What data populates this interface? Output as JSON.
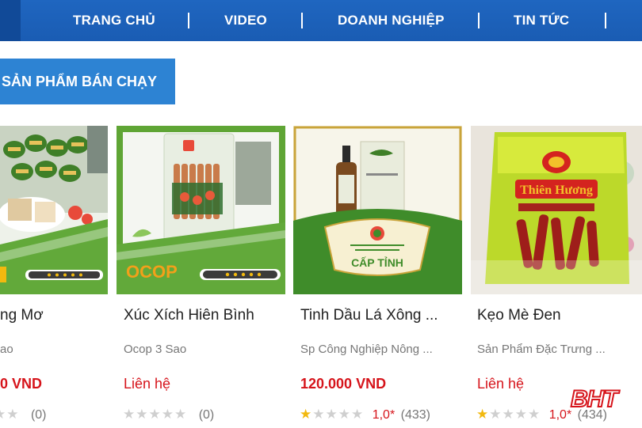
{
  "nav": {
    "items": [
      "TRANG CHỦ",
      "VIDEO",
      "DOANH NGHIỆP",
      "TIN TỨC"
    ]
  },
  "section": {
    "title": "SẢN PHẨM BÁN CHẠY"
  },
  "products": [
    {
      "name": "ng Mơ",
      "category": "ao",
      "price": "0 VND",
      "rating_stars": 0,
      "score": "",
      "count": "(0)"
    },
    {
      "name": "Xúc Xích Hiên Bình",
      "category": "Ocop 3 Sao",
      "price": "Liên hệ",
      "rating_stars": 0,
      "score": "",
      "count": "(0)",
      "badge": "OCOP"
    },
    {
      "name": "Tinh Dầu Lá Xông ...",
      "category": "Sp Công Nghiệp Nông ...",
      "price": "120.000 VND",
      "rating_stars": 1,
      "score": "1,0*",
      "count": "(433)",
      "badge": "CẤP TỈNH"
    },
    {
      "name": "Kẹo Mè Đen",
      "category": "Sản Phẩm Đặc Trưng ...",
      "price": "Liên hệ",
      "rating_stars": 1,
      "score": "1,0*",
      "count": "(434)",
      "brand": "Thiên Hương"
    }
  ],
  "watermark": "BHT",
  "colors": {
    "nav": "#1f66c0",
    "section": "#2d83d3",
    "price": "#d6141b",
    "star_on": "#f2b90f",
    "star_off": "#cfcfcf"
  }
}
